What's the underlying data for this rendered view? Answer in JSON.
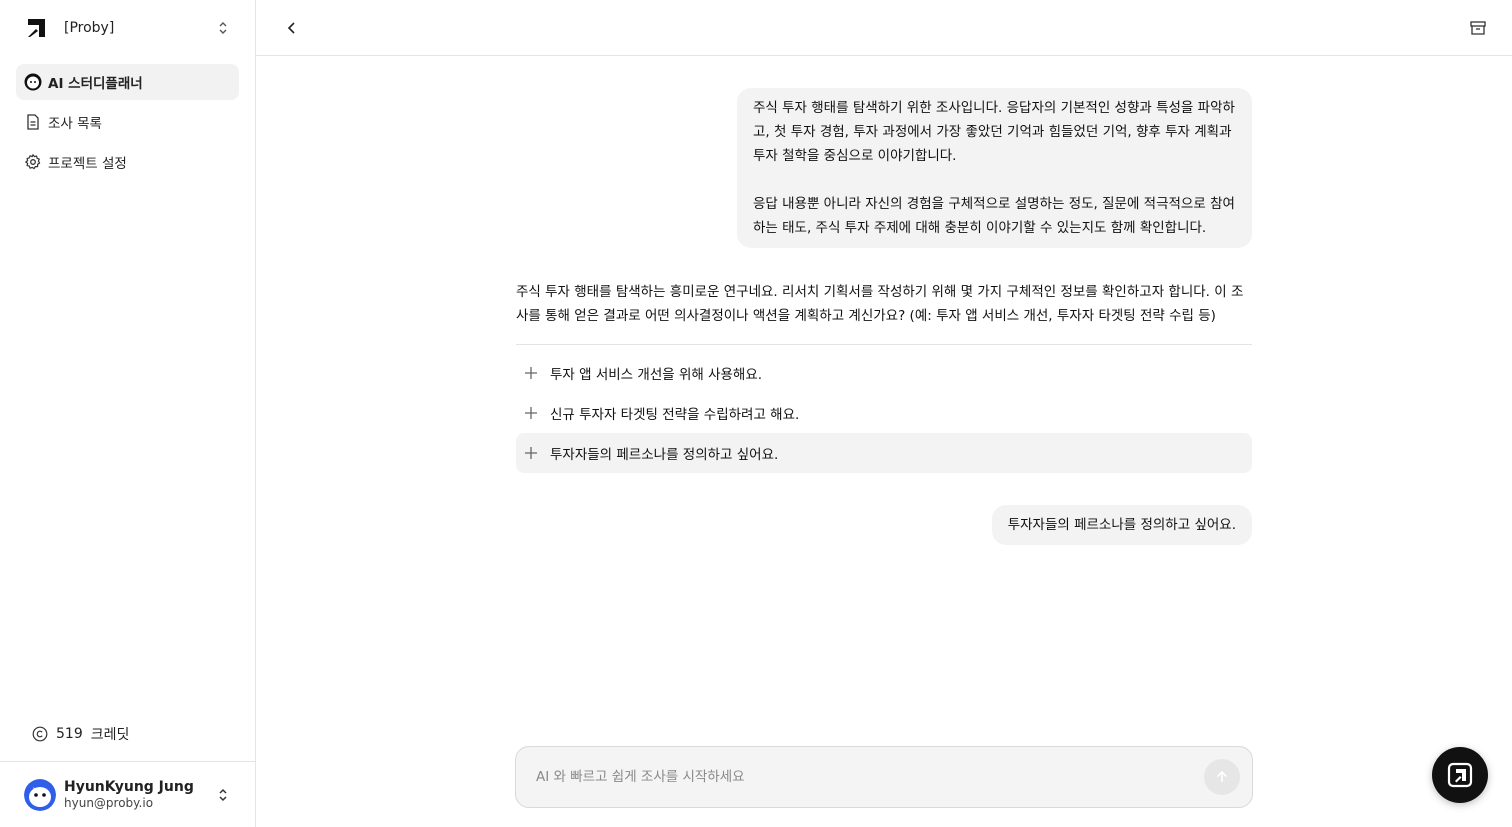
{
  "workspace": {
    "name": "[Proby]",
    "logo_icon": "proby-logo-icon",
    "switch_icon": "chevron-up-down-icon"
  },
  "sidebar": {
    "items": [
      {
        "label": "AI 스터디플래너",
        "icon": "ai-bot-icon",
        "active": true
      },
      {
        "label": "조사 목록",
        "icon": "document-icon",
        "active": false
      },
      {
        "label": "프로젝트 설정",
        "icon": "gear-icon",
        "active": false
      }
    ],
    "credits": {
      "value": "519",
      "label": "크레딧",
      "icon": "copyright-circle-icon"
    },
    "user": {
      "name": "HyunKyung Jung",
      "email": "hyun@proby.io",
      "avatar_icon": "avatar-icon"
    }
  },
  "topbar": {
    "back_icon": "chevron-left-icon",
    "archive_icon": "archive-icon"
  },
  "chat": {
    "user_message_1": {
      "paragraph_1": "주식 투자 행태를 탐색하기 위한 조사입니다. 응답자의 기본적인 성향과 특성을 파악하고, 첫 투자 경험, 투자 과정에서 가장 좋았던 기억과 힘들었던 기억, 향후 투자 계획과 투자 철학을 중심으로 이야기합니다.",
      "paragraph_2": "응답 내용뿐 아니라 자신의 경험을 구체적으로 설명하는 정도, 질문에 적극적으로 참여하는 태도, 주식 투자 주제에 대해 충분히 이야기할 수 있는지도 함께 확인합니다."
    },
    "ai_message": "주식 투자 행태를 탐색하는 흥미로운 연구네요. 리서치 기획서를 작성하기 위해 몇 가지 구체적인 정보를 확인하고자 합니다. 이 조사를 통해 얻은 결과로 어떤 의사결정이나 액션을 계획하고 계신가요? (예: 투자 앱 서비스 개선, 투자자 타겟팅 전략 수립 등)",
    "options": [
      "투자 앱 서비스 개선을 위해 사용해요.",
      "신규 투자자 타겟팅 전략을 수립하려고 해요.",
      "투자자들의 페르소나를 정의하고 싶어요."
    ],
    "user_message_2": "투자자들의 페르소나를 정의하고 싶어요."
  },
  "composer": {
    "placeholder": "AI 와 빠르고 쉽게 조사를 시작하세요",
    "value": "",
    "send_icon": "arrow-up-icon"
  },
  "fab": {
    "icon": "proby-logo-icon"
  },
  "colors": {
    "bubble_bg": "#f3f3f3",
    "border": "#e5e5e5",
    "fab_bg": "#111111",
    "active_nav_bg": "#f2f2f2"
  }
}
